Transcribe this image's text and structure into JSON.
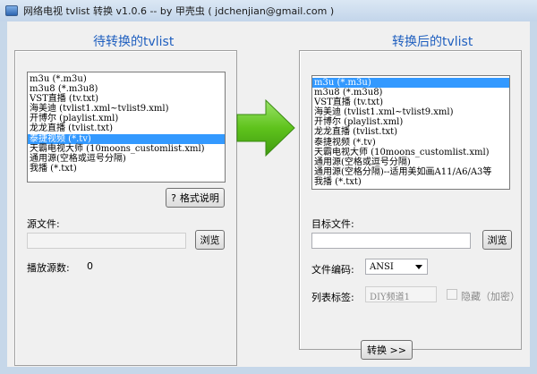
{
  "window": {
    "title": "网络电视 tvlist 转换 v1.0.6  --  by 甲壳虫 ( jdchenjian@gmail.com )"
  },
  "left": {
    "section_title": "待转换的tvlist",
    "items": [
      "m3u (*.m3u)",
      "m3u8 (*.m3u8)",
      "VST直播 (tv.txt)",
      "海美迪 (tvlist1.xml~tvlist9.xml)",
      "开博尔 (playlist.xml)",
      "龙龙直播 (tvlist.txt)",
      "泰捷视频 (*.tv)",
      "天霸电视大师 (10moons_customlist.xml)",
      "通用源(空格或逗号分隔)",
      "我播 (*.txt)"
    ],
    "selected_index": 6,
    "format_help_label": "格式说明",
    "format_help_icon": "?",
    "source_label": "源文件:",
    "source_value": "",
    "browse_label": "浏览",
    "play_count_label": "播放源数:",
    "play_count_value": "0"
  },
  "right": {
    "section_title": "转换后的tvlist",
    "items": [
      "m3u (*.m3u)",
      "m3u8 (*.m3u8)",
      "VST直播 (tv.txt)",
      "海美迪 (tvlist1.xml~tvlist9.xml)",
      "开博尔 (playlist.xml)",
      "龙龙直播 (tvlist.txt)",
      "泰捷视频 (*.tv)",
      "天霸电视大师 (10moons_customlist.xml)",
      "通用源(空格或逗号分隔)",
      "通用源(空格分隔)--适用美如画A11/A6/A3等",
      "我播 (*.txt)"
    ],
    "selected_index": 0,
    "target_label": "目标文件:",
    "target_value": "",
    "browse_label": "浏览",
    "encoding_label": "文件编码:",
    "encoding_value": "ANSI",
    "list_tag_label": "列表标签:",
    "list_tag_placeholder": "DIY频道1",
    "hide_label": "隐藏（加密）"
  },
  "convert_label": "转换 >>",
  "colors": {
    "accent": "#1f5fbf",
    "selection": "#3399ff",
    "arrow": "#5fc31c"
  }
}
